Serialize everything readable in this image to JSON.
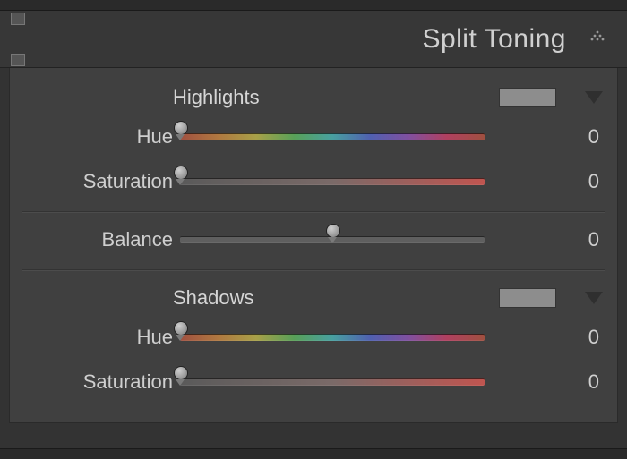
{
  "panel": {
    "title": "Split Toning"
  },
  "highlights": {
    "section_title": "Highlights",
    "hue": {
      "label": "Hue",
      "value": "0",
      "position_pct": 0
    },
    "saturation": {
      "label": "Saturation",
      "value": "0",
      "position_pct": 0
    }
  },
  "balance": {
    "label": "Balance",
    "value": "0",
    "position_pct": 50
  },
  "shadows": {
    "section_title": "Shadows",
    "hue": {
      "label": "Hue",
      "value": "0",
      "position_pct": 0
    },
    "saturation": {
      "label": "Saturation",
      "value": "0",
      "position_pct": 0
    }
  }
}
